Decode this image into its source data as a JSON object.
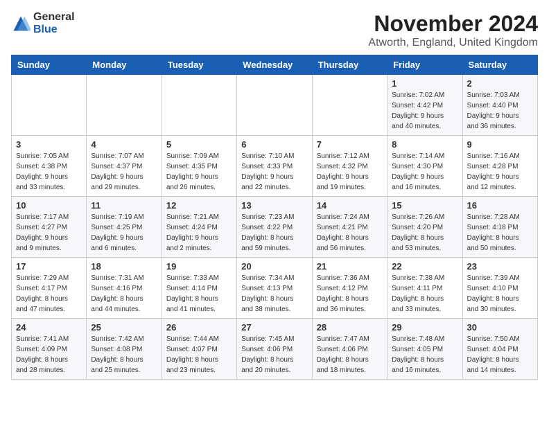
{
  "logo": {
    "general": "General",
    "blue": "Blue"
  },
  "title": "November 2024",
  "subtitle": "Atworth, England, United Kingdom",
  "days_of_week": [
    "Sunday",
    "Monday",
    "Tuesday",
    "Wednesday",
    "Thursday",
    "Friday",
    "Saturday"
  ],
  "weeks": [
    [
      {
        "day": "",
        "info": ""
      },
      {
        "day": "",
        "info": ""
      },
      {
        "day": "",
        "info": ""
      },
      {
        "day": "",
        "info": ""
      },
      {
        "day": "",
        "info": ""
      },
      {
        "day": "1",
        "info": "Sunrise: 7:02 AM\nSunset: 4:42 PM\nDaylight: 9 hours\nand 40 minutes."
      },
      {
        "day": "2",
        "info": "Sunrise: 7:03 AM\nSunset: 4:40 PM\nDaylight: 9 hours\nand 36 minutes."
      }
    ],
    [
      {
        "day": "3",
        "info": "Sunrise: 7:05 AM\nSunset: 4:38 PM\nDaylight: 9 hours\nand 33 minutes."
      },
      {
        "day": "4",
        "info": "Sunrise: 7:07 AM\nSunset: 4:37 PM\nDaylight: 9 hours\nand 29 minutes."
      },
      {
        "day": "5",
        "info": "Sunrise: 7:09 AM\nSunset: 4:35 PM\nDaylight: 9 hours\nand 26 minutes."
      },
      {
        "day": "6",
        "info": "Sunrise: 7:10 AM\nSunset: 4:33 PM\nDaylight: 9 hours\nand 22 minutes."
      },
      {
        "day": "7",
        "info": "Sunrise: 7:12 AM\nSunset: 4:32 PM\nDaylight: 9 hours\nand 19 minutes."
      },
      {
        "day": "8",
        "info": "Sunrise: 7:14 AM\nSunset: 4:30 PM\nDaylight: 9 hours\nand 16 minutes."
      },
      {
        "day": "9",
        "info": "Sunrise: 7:16 AM\nSunset: 4:28 PM\nDaylight: 9 hours\nand 12 minutes."
      }
    ],
    [
      {
        "day": "10",
        "info": "Sunrise: 7:17 AM\nSunset: 4:27 PM\nDaylight: 9 hours\nand 9 minutes."
      },
      {
        "day": "11",
        "info": "Sunrise: 7:19 AM\nSunset: 4:25 PM\nDaylight: 9 hours\nand 6 minutes."
      },
      {
        "day": "12",
        "info": "Sunrise: 7:21 AM\nSunset: 4:24 PM\nDaylight: 9 hours\nand 2 minutes."
      },
      {
        "day": "13",
        "info": "Sunrise: 7:23 AM\nSunset: 4:22 PM\nDaylight: 8 hours\nand 59 minutes."
      },
      {
        "day": "14",
        "info": "Sunrise: 7:24 AM\nSunset: 4:21 PM\nDaylight: 8 hours\nand 56 minutes."
      },
      {
        "day": "15",
        "info": "Sunrise: 7:26 AM\nSunset: 4:20 PM\nDaylight: 8 hours\nand 53 minutes."
      },
      {
        "day": "16",
        "info": "Sunrise: 7:28 AM\nSunset: 4:18 PM\nDaylight: 8 hours\nand 50 minutes."
      }
    ],
    [
      {
        "day": "17",
        "info": "Sunrise: 7:29 AM\nSunset: 4:17 PM\nDaylight: 8 hours\nand 47 minutes."
      },
      {
        "day": "18",
        "info": "Sunrise: 7:31 AM\nSunset: 4:16 PM\nDaylight: 8 hours\nand 44 minutes."
      },
      {
        "day": "19",
        "info": "Sunrise: 7:33 AM\nSunset: 4:14 PM\nDaylight: 8 hours\nand 41 minutes."
      },
      {
        "day": "20",
        "info": "Sunrise: 7:34 AM\nSunset: 4:13 PM\nDaylight: 8 hours\nand 38 minutes."
      },
      {
        "day": "21",
        "info": "Sunrise: 7:36 AM\nSunset: 4:12 PM\nDaylight: 8 hours\nand 36 minutes."
      },
      {
        "day": "22",
        "info": "Sunrise: 7:38 AM\nSunset: 4:11 PM\nDaylight: 8 hours\nand 33 minutes."
      },
      {
        "day": "23",
        "info": "Sunrise: 7:39 AM\nSunset: 4:10 PM\nDaylight: 8 hours\nand 30 minutes."
      }
    ],
    [
      {
        "day": "24",
        "info": "Sunrise: 7:41 AM\nSunset: 4:09 PM\nDaylight: 8 hours\nand 28 minutes."
      },
      {
        "day": "25",
        "info": "Sunrise: 7:42 AM\nSunset: 4:08 PM\nDaylight: 8 hours\nand 25 minutes."
      },
      {
        "day": "26",
        "info": "Sunrise: 7:44 AM\nSunset: 4:07 PM\nDaylight: 8 hours\nand 23 minutes."
      },
      {
        "day": "27",
        "info": "Sunrise: 7:45 AM\nSunset: 4:06 PM\nDaylight: 8 hours\nand 20 minutes."
      },
      {
        "day": "28",
        "info": "Sunrise: 7:47 AM\nSunset: 4:06 PM\nDaylight: 8 hours\nand 18 minutes."
      },
      {
        "day": "29",
        "info": "Sunrise: 7:48 AM\nSunset: 4:05 PM\nDaylight: 8 hours\nand 16 minutes."
      },
      {
        "day": "30",
        "info": "Sunrise: 7:50 AM\nSunset: 4:04 PM\nDaylight: 8 hours\nand 14 minutes."
      }
    ]
  ]
}
